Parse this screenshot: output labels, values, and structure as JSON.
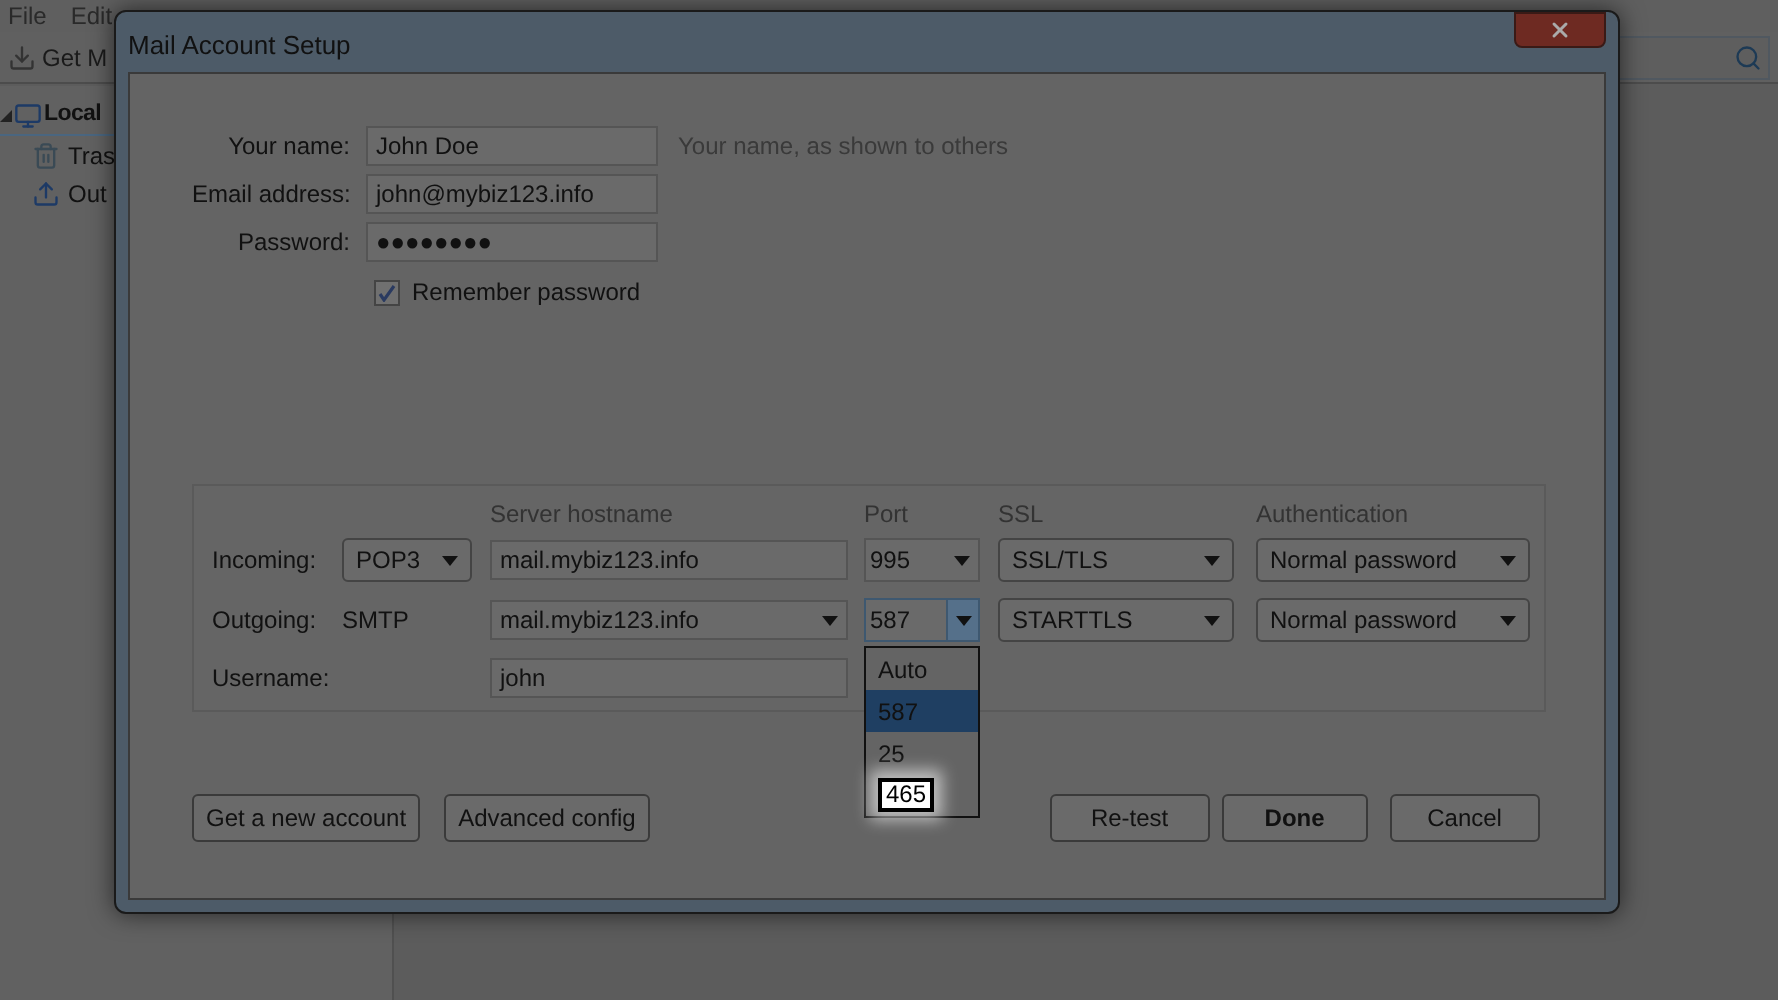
{
  "app": {
    "menu": [
      {
        "label": "File"
      },
      {
        "label": "Edit"
      }
    ],
    "toolbar": {
      "get_mail": "Get M"
    },
    "folders": [
      {
        "label": "Local",
        "kind": "computer",
        "selected": true,
        "expanded": true,
        "children": [
          {
            "label": "Tras",
            "kind": "trash",
            "selected": false
          },
          {
            "label": "Out",
            "kind": "outbox",
            "selected": false
          }
        ]
      }
    ]
  },
  "dialog": {
    "title": "Mail Account Setup",
    "fields": [
      {
        "label": "Your name:",
        "value": "John Doe",
        "hint": "Your name, as shown to others"
      },
      {
        "label": "Email address:",
        "value": "john@mybiz123.info"
      },
      {
        "label": "Password:",
        "value": "●●●●●●●●"
      }
    ],
    "remember_password": {
      "label": "Remember password",
      "checked": true
    },
    "server": {
      "columns": [
        "Server hostname",
        "Port",
        "SSL",
        "Authentication"
      ],
      "rows": [
        {
          "kind": "server",
          "label": "Incoming:",
          "protocol": {
            "kind": "select",
            "text": "POP3"
          },
          "hostname": {
            "value": "mail.mybiz123.info",
            "dropdown": false
          },
          "port": {
            "value": "995",
            "open": false
          },
          "ssl": "SSL/TLS",
          "auth": "Normal password"
        },
        {
          "kind": "server",
          "label": "Outgoing:",
          "protocol": {
            "kind": "text",
            "text": "SMTP"
          },
          "hostname": {
            "value": "mail.mybiz123.info",
            "dropdown": true
          },
          "port": {
            "value": "587",
            "open": true,
            "options": [
              {
                "label": "Auto",
                "selected": false,
                "emphasized": false
              },
              {
                "label": "587",
                "selected": true,
                "emphasized": false
              },
              {
                "label": "25",
                "selected": false,
                "emphasized": false
              },
              {
                "label": "465",
                "selected": false,
                "emphasized": true
              }
            ]
          },
          "ssl": "STARTTLS",
          "auth": "Normal password"
        },
        {
          "kind": "username",
          "label": "Username:",
          "value": "john"
        }
      ]
    },
    "buttons": [
      {
        "label": "Get a new account",
        "default": false
      },
      {
        "label": "Advanced config",
        "default": false
      },
      {
        "label": "Re-test",
        "default": false
      },
      {
        "label": "Done",
        "default": true
      },
      {
        "label": "Cancel",
        "default": false
      }
    ]
  }
}
